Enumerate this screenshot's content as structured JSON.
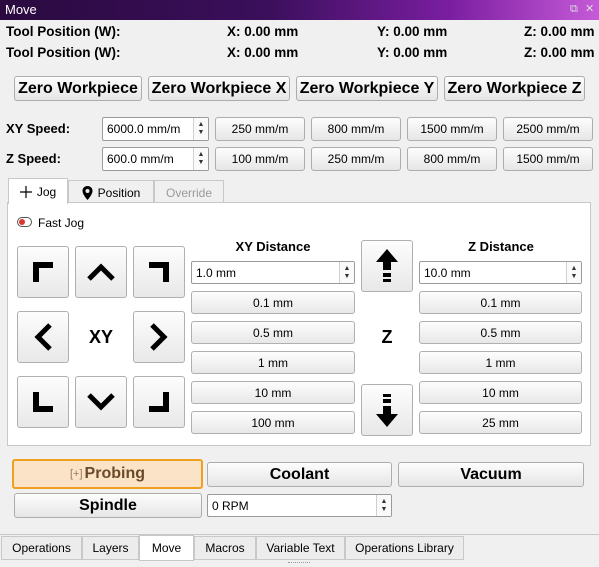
{
  "window": {
    "title": "Move"
  },
  "positions": [
    {
      "label": "Tool Position (W):",
      "x": "X: 0.00 mm",
      "y": "Y: 0.00 mm",
      "z": "Z: 0.00 mm"
    },
    {
      "label": "Tool Position (W):",
      "x": "X: 0.00 mm",
      "y": "Y: 0.00 mm",
      "z": "Z: 0.00 mm"
    }
  ],
  "zero_buttons": [
    "Zero Workpiece",
    "Zero Workpiece X",
    "Zero Workpiece Y",
    "Zero Workpiece Z"
  ],
  "xy_speed": {
    "label": "XY Speed:",
    "value": "6000.0 mm/m",
    "presets": [
      "250 mm/m",
      "800 mm/m",
      "1500 mm/m",
      "2500 mm/m"
    ]
  },
  "z_speed": {
    "label": "Z Speed:",
    "value": "600.0 mm/m",
    "presets": [
      "100 mm/m",
      "250 mm/m",
      "800 mm/m",
      "1500 mm/m"
    ]
  },
  "tabs": [
    {
      "label": "Jog",
      "icon": "move-cross-icon",
      "state": "active"
    },
    {
      "label": "Position",
      "icon": "location-pin-icon",
      "state": "normal"
    },
    {
      "label": "Override",
      "icon": "",
      "state": "disabled"
    }
  ],
  "jog": {
    "fast_jog_label": "Fast Jog",
    "xy_center_label": "XY",
    "z_center_label": "Z",
    "xy_distance": {
      "title": "XY Distance",
      "value": "1.0 mm",
      "presets": [
        "0.1 mm",
        "0.5 mm",
        "1 mm",
        "10 mm",
        "100 mm"
      ]
    },
    "z_distance": {
      "title": "Z Distance",
      "value": "10.0 mm",
      "presets": [
        "0.1 mm",
        "0.5 mm",
        "1 mm",
        "10 mm",
        "25 mm"
      ]
    }
  },
  "actions": {
    "probing": "Probing",
    "coolant": "Coolant",
    "vacuum": "Vacuum",
    "spindle": "Spindle",
    "rpm_value": "0 RPM"
  },
  "bottom_tabs": [
    "Operations",
    "Layers",
    "Move",
    "Macros",
    "Variable Text",
    "Operations Library"
  ],
  "bottom_tab_active": "Move",
  "colors": {
    "probing_border": "#f0a020",
    "probing_bg": "#fbe3c8",
    "probing_text": "#6b4a2a"
  }
}
